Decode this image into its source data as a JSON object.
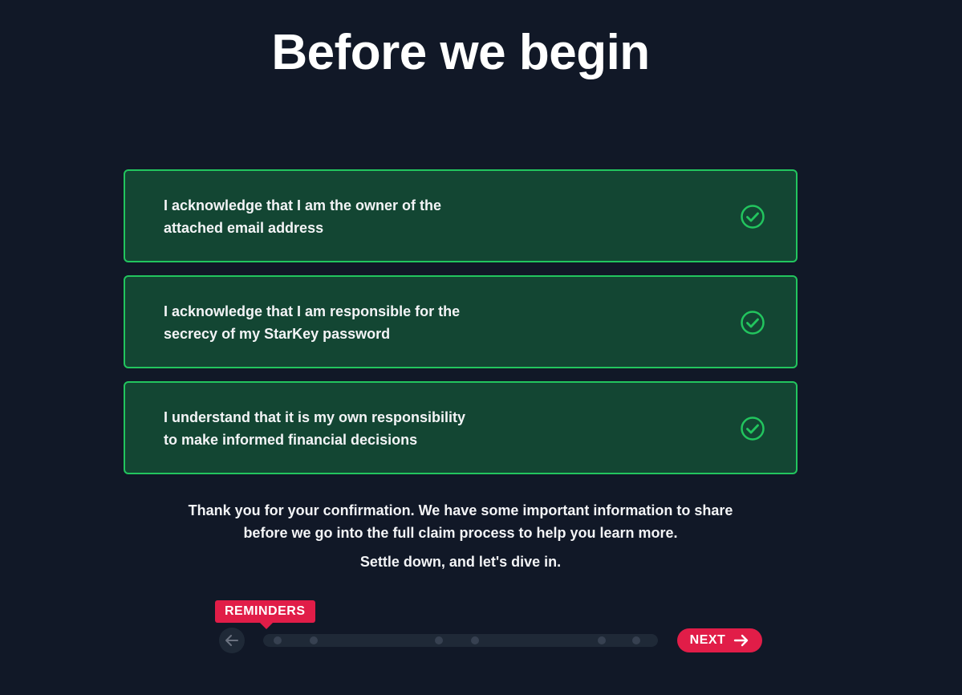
{
  "title": "Before we begin",
  "acknowledgements": [
    {
      "line1": "I acknowledge that I am the owner of the",
      "line2": "attached email address",
      "checked": true,
      "icon": "check-circle-icon"
    },
    {
      "line1": "I acknowledge that I am responsible for the",
      "line2": "secrecy of my StarKey password",
      "checked": true,
      "icon": "check-circle-icon"
    },
    {
      "line1": "I understand that it is my own responsibility",
      "line2": "to make informed financial decisions",
      "checked": true,
      "icon": "check-circle-icon"
    }
  ],
  "info": {
    "line1": "Thank you for your confirmation. We have some important information to share",
    "line2": "before we go into the full claim process to help you learn more.",
    "line3": "Settle down, and let's dive in."
  },
  "stepper": {
    "tooltip": "REMINDERS",
    "back_icon": "arrow-left-icon",
    "next_label": "NEXT",
    "next_icon": "arrow-right-icon",
    "dot_count": 6
  },
  "colors": {
    "background": "#111827",
    "card": "#134633",
    "card_border": "#22c55e",
    "accent": "#e11d48"
  }
}
